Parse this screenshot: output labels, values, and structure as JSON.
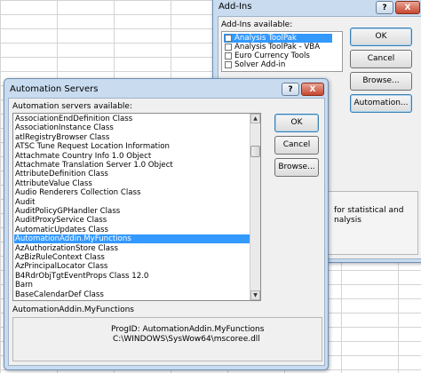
{
  "addins": {
    "title": "Add-Ins",
    "available_label": "Add-Ins available:",
    "items": [
      {
        "label": "Analysis ToolPak",
        "selected": true
      },
      {
        "label": "Analysis ToolPak - VBA",
        "selected": false
      },
      {
        "label": "Euro Currency Tools",
        "selected": false
      },
      {
        "label": "Solver Add-in",
        "selected": false
      }
    ],
    "ok_label": "OK",
    "cancel_label": "Cancel",
    "browse_label": "Browse...",
    "automation_label": "Automation...",
    "help_label": "?",
    "close_label": "X",
    "desc_line1": "for statistical and",
    "desc_line2": "nalysis"
  },
  "automation": {
    "title": "Automation Servers",
    "help_label": "?",
    "close_label": "X",
    "available_label": "Automation servers available:",
    "servers": [
      "AssociationEndDefinition Class",
      "AssociationInstance Class",
      "atlRegistryBrowser Class",
      "ATSC Tune Request Location Information",
      "Attachmate Country Info 1.0 Object",
      "Attachmate Translation Server 1.0 Object",
      "AttributeDefinition Class",
      "AttributeValue Class",
      "Audio Renderers Collection Class",
      "Audit",
      "AuditPolicyGPHandler Class",
      "AuditProxyService Class",
      "AutomaticUpdates Class",
      "AutomationAddin.MyFunctions",
      "AzAuthorizationStore Class",
      "AzBizRuleContext Class",
      "AzPrincipalLocator Class",
      "B4RdrObjTgtEventProps Class 12.0",
      "Barn",
      "BaseCalendarDef Class"
    ],
    "selected_index": 13,
    "ok_label": "OK",
    "cancel_label": "Cancel",
    "browse_label": "Browse...",
    "selected_name": "AutomationAddin.MyFunctions",
    "progid_line": "ProgID: AutomationAddin.MyFunctions",
    "path_line": "C:\\WINDOWS\\SysWow64\\mscoree.dll"
  }
}
